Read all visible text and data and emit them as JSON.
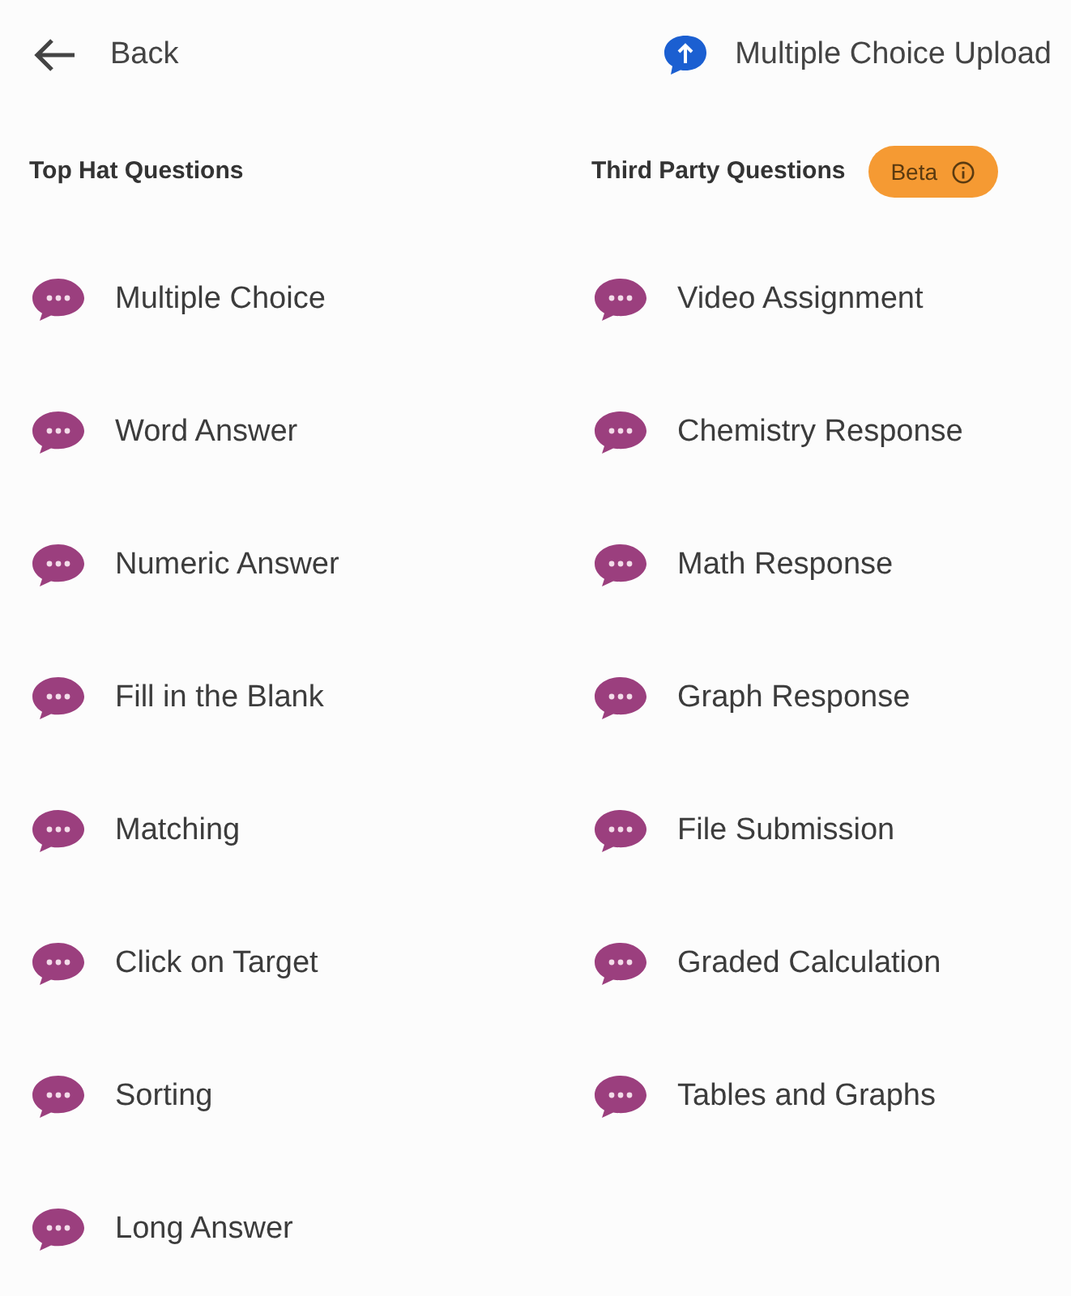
{
  "header": {
    "back": "Back",
    "upload": "Multiple Choice Upload"
  },
  "top_hat": {
    "title": "Top Hat Questions",
    "items": [
      "Multiple Choice",
      "Word Answer",
      "Numeric Answer",
      "Fill in the Blank",
      "Matching",
      "Click on Target",
      "Sorting",
      "Long Answer"
    ]
  },
  "third_party": {
    "title": "Third Party Questions",
    "badge": "Beta",
    "items": [
      "Video Assignment",
      "Chemistry Response",
      "Math Response",
      "Graph Response",
      "File Submission",
      "Graded Calculation",
      "Tables and Graphs"
    ]
  }
}
